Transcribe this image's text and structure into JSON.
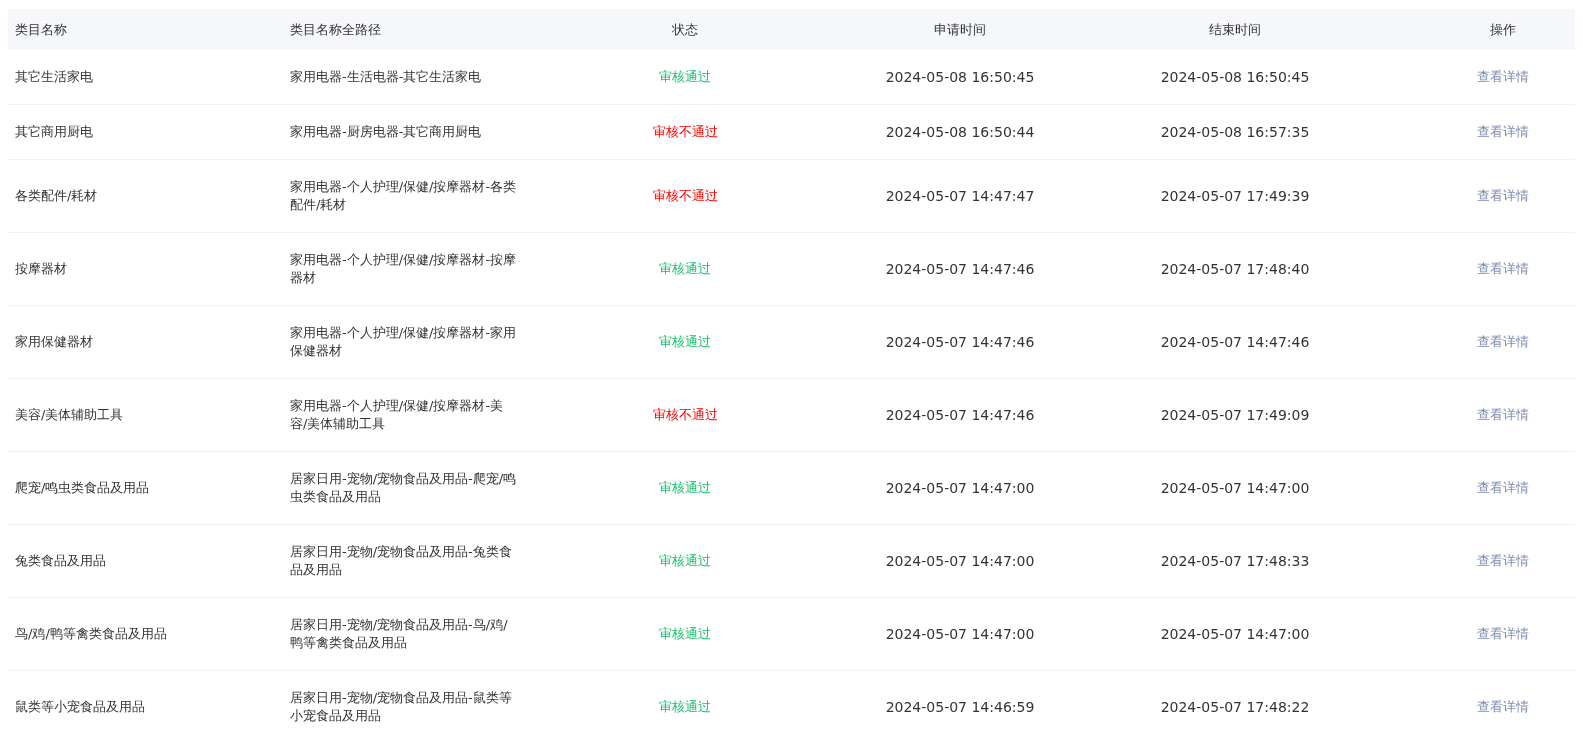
{
  "table": {
    "columns": [
      "类目名称",
      "类目名称全路径",
      "状态",
      "申请时间",
      "结束时间",
      "操作"
    ],
    "rows": [
      {
        "name": "其它生活家电",
        "path": "家用电器-生活电器-其它生活家电",
        "status": {
          "kind": "approved",
          "text": "审核通过"
        },
        "applied": "2024-05-08 16:50:45",
        "ended": "2024-05-08 16:50:45",
        "action": "查看详情"
      },
      {
        "name": "其它商用厨电",
        "path": "家用电器-厨房电器-其它商用厨电",
        "status": {
          "kind": "rejected",
          "text": "审核不通过"
        },
        "applied": "2024-05-08 16:50:44",
        "ended": "2024-05-08 16:57:35",
        "action": "查看详情"
      },
      {
        "name": "各类配件/耗材",
        "path": "家用电器-个人护理/保健/按摩器材-各类配件/耗材",
        "status": {
          "kind": "rejected",
          "text": "审核不通过"
        },
        "applied": "2024-05-07 14:47:47",
        "ended": "2024-05-07 17:49:39",
        "action": "查看详情"
      },
      {
        "name": "按摩器材",
        "path": "家用电器-个人护理/保健/按摩器材-按摩器材",
        "status": {
          "kind": "approved",
          "text": "审核通过"
        },
        "applied": "2024-05-07 14:47:46",
        "ended": "2024-05-07 17:48:40",
        "action": "查看详情"
      },
      {
        "name": "家用保健器材",
        "path": "家用电器-个人护理/保健/按摩器材-家用保健器材",
        "status": {
          "kind": "approved",
          "text": "审核通过"
        },
        "applied": "2024-05-07 14:47:46",
        "ended": "2024-05-07 14:47:46",
        "action": "查看详情"
      },
      {
        "name": "美容/美体辅助工具",
        "path": "家用电器-个人护理/保健/按摩器材-美容/美体辅助工具",
        "status": {
          "kind": "rejected",
          "text": "审核不通过"
        },
        "applied": "2024-05-07 14:47:46",
        "ended": "2024-05-07 17:49:09",
        "action": "查看详情"
      },
      {
        "name": "爬宠/鸣虫类食品及用品",
        "path": "居家日用-宠物/宠物食品及用品-爬宠/鸣虫类食品及用品",
        "status": {
          "kind": "approved",
          "text": "审核通过"
        },
        "applied": "2024-05-07 14:47:00",
        "ended": "2024-05-07 14:47:00",
        "action": "查看详情"
      },
      {
        "name": "兔类食品及用品",
        "path": "居家日用-宠物/宠物食品及用品-兔类食品及用品",
        "status": {
          "kind": "approved",
          "text": "审核通过"
        },
        "applied": "2024-05-07 14:47:00",
        "ended": "2024-05-07 17:48:33",
        "action": "查看详情"
      },
      {
        "name": "鸟/鸡/鸭等禽类食品及用品",
        "path": "居家日用-宠物/宠物食品及用品-鸟/鸡/鸭等禽类食品及用品",
        "status": {
          "kind": "approved",
          "text": "审核通过"
        },
        "applied": "2024-05-07 14:47:00",
        "ended": "2024-05-07 14:47:00",
        "action": "查看详情"
      },
      {
        "name": "鼠类等小宠食品及用品",
        "path": "居家日用-宠物/宠物食品及用品-鼠类等小宠食品及用品",
        "status": {
          "kind": "approved",
          "text": "审核通过"
        },
        "applied": "2024-05-07 14:46:59",
        "ended": "2024-05-07 17:48:22",
        "action": "查看详情"
      }
    ]
  }
}
